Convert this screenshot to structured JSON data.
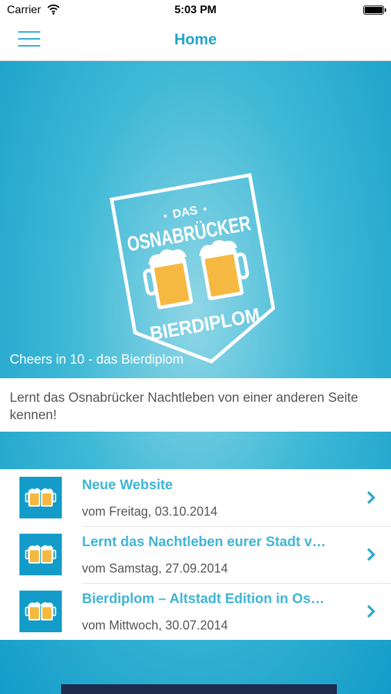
{
  "status_bar": {
    "carrier": "Carrier",
    "time": "5:03 PM"
  },
  "nav": {
    "title": "Home"
  },
  "hero": {
    "badge_top": "DAS",
    "badge_middle": "OSNABRÜCKER",
    "badge_bottom": "BIERDIPLOM",
    "caption": "Cheers in 10 - das Bierdiplom"
  },
  "description": "Lernt das Osnabrücker Nachtleben von einer anderen Seite kennen!",
  "news": [
    {
      "title": "Neue Website",
      "date": "vom Freitag, 03.10.2014"
    },
    {
      "title": "Lernt das Nachtleben eurer Stadt v…",
      "date": "vom Samstag, 27.09.2014"
    },
    {
      "title": "Bierdiplom – Altstadt Edition in Os…",
      "date": "vom Mittwoch, 30.07.2014"
    }
  ],
  "colors": {
    "accent": "#22a4cb",
    "beer": "#f5b942",
    "foam": "#ffffff",
    "background": "#139cc9"
  }
}
